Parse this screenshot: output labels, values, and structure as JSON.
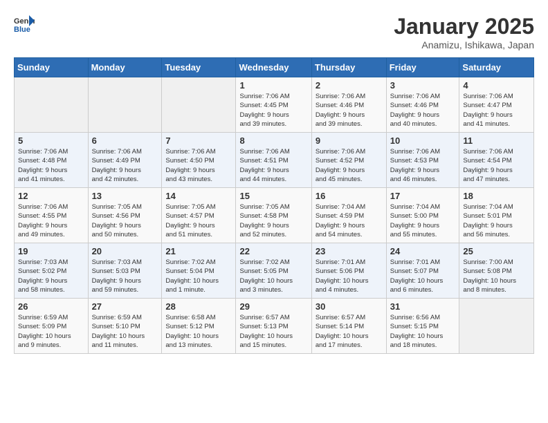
{
  "header": {
    "logo_line1": "General",
    "logo_line2": "Blue",
    "title": "January 2025",
    "subtitle": "Anamizu, Ishikawa, Japan"
  },
  "weekdays": [
    "Sunday",
    "Monday",
    "Tuesday",
    "Wednesday",
    "Thursday",
    "Friday",
    "Saturday"
  ],
  "weeks": [
    [
      {
        "num": "",
        "info": ""
      },
      {
        "num": "",
        "info": ""
      },
      {
        "num": "",
        "info": ""
      },
      {
        "num": "1",
        "info": "Sunrise: 7:06 AM\nSunset: 4:45 PM\nDaylight: 9 hours\nand 39 minutes."
      },
      {
        "num": "2",
        "info": "Sunrise: 7:06 AM\nSunset: 4:46 PM\nDaylight: 9 hours\nand 39 minutes."
      },
      {
        "num": "3",
        "info": "Sunrise: 7:06 AM\nSunset: 4:46 PM\nDaylight: 9 hours\nand 40 minutes."
      },
      {
        "num": "4",
        "info": "Sunrise: 7:06 AM\nSunset: 4:47 PM\nDaylight: 9 hours\nand 41 minutes."
      }
    ],
    [
      {
        "num": "5",
        "info": "Sunrise: 7:06 AM\nSunset: 4:48 PM\nDaylight: 9 hours\nand 41 minutes."
      },
      {
        "num": "6",
        "info": "Sunrise: 7:06 AM\nSunset: 4:49 PM\nDaylight: 9 hours\nand 42 minutes."
      },
      {
        "num": "7",
        "info": "Sunrise: 7:06 AM\nSunset: 4:50 PM\nDaylight: 9 hours\nand 43 minutes."
      },
      {
        "num": "8",
        "info": "Sunrise: 7:06 AM\nSunset: 4:51 PM\nDaylight: 9 hours\nand 44 minutes."
      },
      {
        "num": "9",
        "info": "Sunrise: 7:06 AM\nSunset: 4:52 PM\nDaylight: 9 hours\nand 45 minutes."
      },
      {
        "num": "10",
        "info": "Sunrise: 7:06 AM\nSunset: 4:53 PM\nDaylight: 9 hours\nand 46 minutes."
      },
      {
        "num": "11",
        "info": "Sunrise: 7:06 AM\nSunset: 4:54 PM\nDaylight: 9 hours\nand 47 minutes."
      }
    ],
    [
      {
        "num": "12",
        "info": "Sunrise: 7:06 AM\nSunset: 4:55 PM\nDaylight: 9 hours\nand 49 minutes."
      },
      {
        "num": "13",
        "info": "Sunrise: 7:05 AM\nSunset: 4:56 PM\nDaylight: 9 hours\nand 50 minutes."
      },
      {
        "num": "14",
        "info": "Sunrise: 7:05 AM\nSunset: 4:57 PM\nDaylight: 9 hours\nand 51 minutes."
      },
      {
        "num": "15",
        "info": "Sunrise: 7:05 AM\nSunset: 4:58 PM\nDaylight: 9 hours\nand 52 minutes."
      },
      {
        "num": "16",
        "info": "Sunrise: 7:04 AM\nSunset: 4:59 PM\nDaylight: 9 hours\nand 54 minutes."
      },
      {
        "num": "17",
        "info": "Sunrise: 7:04 AM\nSunset: 5:00 PM\nDaylight: 9 hours\nand 55 minutes."
      },
      {
        "num": "18",
        "info": "Sunrise: 7:04 AM\nSunset: 5:01 PM\nDaylight: 9 hours\nand 56 minutes."
      }
    ],
    [
      {
        "num": "19",
        "info": "Sunrise: 7:03 AM\nSunset: 5:02 PM\nDaylight: 9 hours\nand 58 minutes."
      },
      {
        "num": "20",
        "info": "Sunrise: 7:03 AM\nSunset: 5:03 PM\nDaylight: 9 hours\nand 59 minutes."
      },
      {
        "num": "21",
        "info": "Sunrise: 7:02 AM\nSunset: 5:04 PM\nDaylight: 10 hours\nand 1 minute."
      },
      {
        "num": "22",
        "info": "Sunrise: 7:02 AM\nSunset: 5:05 PM\nDaylight: 10 hours\nand 3 minutes."
      },
      {
        "num": "23",
        "info": "Sunrise: 7:01 AM\nSunset: 5:06 PM\nDaylight: 10 hours\nand 4 minutes."
      },
      {
        "num": "24",
        "info": "Sunrise: 7:01 AM\nSunset: 5:07 PM\nDaylight: 10 hours\nand 6 minutes."
      },
      {
        "num": "25",
        "info": "Sunrise: 7:00 AM\nSunset: 5:08 PM\nDaylight: 10 hours\nand 8 minutes."
      }
    ],
    [
      {
        "num": "26",
        "info": "Sunrise: 6:59 AM\nSunset: 5:09 PM\nDaylight: 10 hours\nand 9 minutes."
      },
      {
        "num": "27",
        "info": "Sunrise: 6:59 AM\nSunset: 5:10 PM\nDaylight: 10 hours\nand 11 minutes."
      },
      {
        "num": "28",
        "info": "Sunrise: 6:58 AM\nSunset: 5:12 PM\nDaylight: 10 hours\nand 13 minutes."
      },
      {
        "num": "29",
        "info": "Sunrise: 6:57 AM\nSunset: 5:13 PM\nDaylight: 10 hours\nand 15 minutes."
      },
      {
        "num": "30",
        "info": "Sunrise: 6:57 AM\nSunset: 5:14 PM\nDaylight: 10 hours\nand 17 minutes."
      },
      {
        "num": "31",
        "info": "Sunrise: 6:56 AM\nSunset: 5:15 PM\nDaylight: 10 hours\nand 18 minutes."
      },
      {
        "num": "",
        "info": ""
      }
    ]
  ]
}
